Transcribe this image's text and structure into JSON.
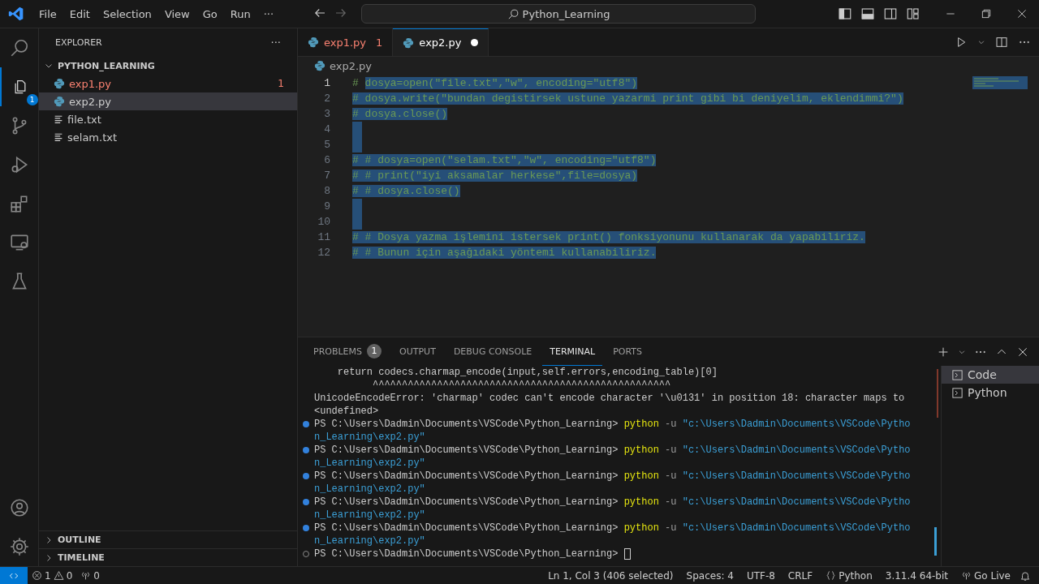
{
  "title_bar": {
    "menu": [
      "File",
      "Edit",
      "Selection",
      "View",
      "Go",
      "Run",
      "···"
    ],
    "search": {
      "value": "Python_Learning"
    }
  },
  "activity_bar": {
    "items": [
      {
        "selected": false
      },
      {
        "selected": true,
        "badge": "1"
      },
      {
        "selected": false
      },
      {
        "selected": false
      },
      {
        "selected": false
      },
      {
        "selected": false
      },
      {
        "selected": false
      }
    ]
  },
  "sidebar": {
    "title": "EXPLORER",
    "more": "···",
    "tree": [
      {
        "label": "PYTHON_LEARNING",
        "kind": "folder",
        "expanded": true,
        "children": [
          {
            "label": "exp1.py",
            "kind": "python",
            "error": true,
            "badge": "1",
            "selected": false
          },
          {
            "label": "exp2.py",
            "kind": "python",
            "error": false,
            "selected": true
          },
          {
            "label": "file.txt",
            "kind": "text",
            "error": false,
            "selected": false
          },
          {
            "label": "selam.txt",
            "kind": "text",
            "error": false,
            "selected": false
          }
        ]
      }
    ],
    "sections": [
      {
        "label": "OUTLINE",
        "expanded": false
      },
      {
        "label": "TIMELINE",
        "expanded": false
      }
    ]
  },
  "editor": {
    "tabs": [
      {
        "label": "exp1.py",
        "error": true,
        "badge": "1",
        "modified": false,
        "selected": false
      },
      {
        "label": "exp2.py",
        "error": false,
        "modified": true,
        "selected": true
      }
    ],
    "breadcrumb": "exp2.py",
    "lines": [
      {
        "number": "1",
        "active": true,
        "parts": [
          {
            "text": "# ",
            "selected": false
          },
          {
            "text": "dosya=open(\"file.txt\",\"w\", encoding=\"utf8\")",
            "selected": true
          }
        ]
      },
      {
        "number": "2",
        "active": false,
        "parts": [
          {
            "text": "# dosya.write(\"bundan degistirsek ustune yazarmi print gibi bi deniyelim, eklendimmi?\")",
            "selected": true
          }
        ]
      },
      {
        "number": "3",
        "active": false,
        "parts": [
          {
            "text": "# dosya.close()",
            "selected": true
          }
        ]
      },
      {
        "number": "4",
        "active": false,
        "selected": true
      },
      {
        "number": "5",
        "active": false,
        "selected": true
      },
      {
        "number": "6",
        "active": false,
        "parts": [
          {
            "text": "# # dosya=open(\"selam.txt\",\"w\", encoding=\"utf8\")",
            "selected": true
          }
        ]
      },
      {
        "number": "7",
        "active": false,
        "parts": [
          {
            "text": "# # print(\"iyi aksamalar herkese\",file=dosya)",
            "selected": true
          }
        ]
      },
      {
        "number": "8",
        "active": false,
        "parts": [
          {
            "text": "# # dosya.close()",
            "selected": true
          }
        ]
      },
      {
        "number": "9",
        "active": false,
        "selected": true
      },
      {
        "number": "10",
        "active": false,
        "selected": true
      },
      {
        "number": "11",
        "active": false,
        "parts": [
          {
            "text": "# # Dosya yazma işlemini istersek print() fonksiyonunu kullanarak da yapabiliriz.",
            "selected": true
          }
        ]
      },
      {
        "number": "12",
        "active": false,
        "parts": [
          {
            "text": "# # Bunun için aşağıdaki yöntemi kullanabiliriz.",
            "selected": true
          }
        ]
      }
    ]
  },
  "panel": {
    "tabs": [
      {
        "label": "PROBLEMS",
        "badge": "1",
        "selected": false
      },
      {
        "label": "OUTPUT",
        "selected": false
      },
      {
        "label": "DEBUG CONSOLE",
        "selected": false
      },
      {
        "label": "TERMINAL",
        "selected": true
      },
      {
        "label": "PORTS",
        "selected": false
      }
    ],
    "terminals": [
      {
        "label": "Code",
        "selected": true
      },
      {
        "label": "Python",
        "selected": false
      }
    ],
    "terminal_lines": [
      {
        "kind": "output",
        "parts": [
          {
            "kind": "plain",
            "text": "    return codecs.charmap_encode(input,self.errors,encoding_table)[0]"
          }
        ]
      },
      {
        "kind": "output",
        "parts": [
          {
            "kind": "plain",
            "text": "          ^^^^^^^^^^^^^^^^^^^^^^^^^^^^^^^^^^^^^^^^^^^^^^^^^^^"
          }
        ]
      },
      {
        "kind": "output",
        "parts": [
          {
            "kind": "plain",
            "text": "UnicodeEncodeError: 'charmap' codec can't encode character '\\u0131' in position 18: character maps to"
          }
        ]
      },
      {
        "kind": "output",
        "parts": [
          {
            "kind": "plain",
            "text": "<undefined>"
          }
        ]
      },
      {
        "kind": "command",
        "parts": [
          {
            "kind": "plain",
            "text": "PS C:\\Users\\Dadmin\\Documents\\VSCode\\Python_Learning> "
          },
          {
            "kind": "command",
            "text": "python"
          },
          {
            "kind": "flag",
            "text": " -u "
          },
          {
            "kind": "string",
            "text": "\"c:\\Users\\Dadmin\\Documents\\VSCode\\Pytho"
          }
        ]
      },
      {
        "kind": "output",
        "parts": [
          {
            "kind": "string",
            "text": "n_Learning\\exp2.py\""
          }
        ]
      },
      {
        "kind": "command",
        "parts": [
          {
            "kind": "plain",
            "text": "PS C:\\Users\\Dadmin\\Documents\\VSCode\\Python_Learning> "
          },
          {
            "kind": "command",
            "text": "python"
          },
          {
            "kind": "flag",
            "text": " -u "
          },
          {
            "kind": "string",
            "text": "\"c:\\Users\\Dadmin\\Documents\\VSCode\\Pytho"
          }
        ]
      },
      {
        "kind": "output",
        "parts": [
          {
            "kind": "string",
            "text": "n_Learning\\exp2.py\""
          }
        ]
      },
      {
        "kind": "command",
        "parts": [
          {
            "kind": "plain",
            "text": "PS C:\\Users\\Dadmin\\Documents\\VSCode\\Python_Learning> "
          },
          {
            "kind": "command",
            "text": "python"
          },
          {
            "kind": "flag",
            "text": " -u "
          },
          {
            "kind": "string",
            "text": "\"c:\\Users\\Dadmin\\Documents\\VSCode\\Pytho"
          }
        ]
      },
      {
        "kind": "output",
        "parts": [
          {
            "kind": "string",
            "text": "n_Learning\\exp2.py\""
          }
        ]
      },
      {
        "kind": "command",
        "parts": [
          {
            "kind": "plain",
            "text": "PS C:\\Users\\Dadmin\\Documents\\VSCode\\Python_Learning> "
          },
          {
            "kind": "command",
            "text": "python"
          },
          {
            "kind": "flag",
            "text": " -u "
          },
          {
            "kind": "string",
            "text": "\"c:\\Users\\Dadmin\\Documents\\VSCode\\Pytho"
          }
        ]
      },
      {
        "kind": "output",
        "parts": [
          {
            "kind": "string",
            "text": "n_Learning\\exp2.py\""
          }
        ]
      },
      {
        "kind": "command",
        "parts": [
          {
            "kind": "plain",
            "text": "PS C:\\Users\\Dadmin\\Documents\\VSCode\\Python_Learning> "
          },
          {
            "kind": "command",
            "text": "python"
          },
          {
            "kind": "flag",
            "text": " -u "
          },
          {
            "kind": "string",
            "text": "\"c:\\Users\\Dadmin\\Documents\\VSCode\\Pytho"
          }
        ]
      },
      {
        "kind": "output",
        "parts": [
          {
            "kind": "string",
            "text": "n_Learning\\exp2.py\""
          }
        ]
      },
      {
        "kind": "prompt",
        "cursor": true,
        "parts": [
          {
            "kind": "plain",
            "text": "PS C:\\Users\\Dadmin\\Documents\\VSCode\\Python_Learning> "
          }
        ]
      }
    ]
  },
  "status_bar": {
    "errors": "1",
    "warnings": "0",
    "ports": "0",
    "right": [
      {
        "kind": "text",
        "text": "Ln 1, Col 3 (406 selected)"
      },
      {
        "kind": "text",
        "text": "Spaces: 4"
      },
      {
        "kind": "text",
        "text": "UTF-8"
      },
      {
        "kind": "text",
        "text": "CRLF"
      },
      {
        "kind": "language",
        "text": "Python"
      },
      {
        "kind": "text",
        "text": "3.11.4 64-bit"
      },
      {
        "kind": "live",
        "text": "Go Live"
      },
      {
        "kind": "bell"
      }
    ]
  }
}
